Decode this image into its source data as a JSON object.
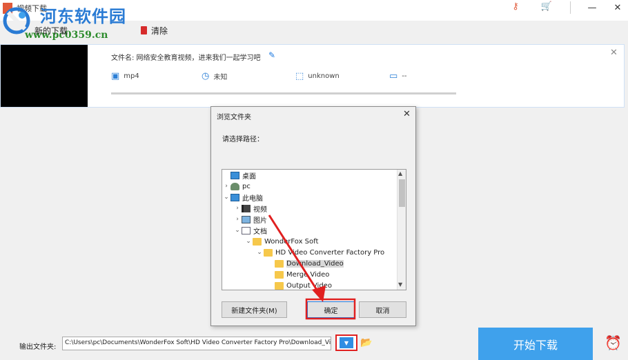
{
  "window": {
    "title": "视频下载"
  },
  "watermark": {
    "site_name": "河东软件园",
    "url": "www.pc0359.cn"
  },
  "toolbar": {
    "new_download": "新的下载",
    "clear": "清除"
  },
  "task": {
    "file_name_label": "文件名: 网络安全教育视频，进来我们一起学习吧",
    "format": "mp4",
    "duration": "未知",
    "resolution": "unknown",
    "size": "--",
    "progress": 0
  },
  "dialog": {
    "title": "浏览文件夹",
    "prompt": "请选择路径：",
    "tree": [
      {
        "label": "桌面",
        "icon": "desktop-icon",
        "arrow": ""
      },
      {
        "label": "pc",
        "icon": "user-icon",
        "arrow": "›"
      },
      {
        "label": "此电脑",
        "icon": "computer-icon",
        "arrow": "⌄"
      },
      {
        "label": "视频",
        "icon": "video-folder-icon",
        "arrow": "›"
      },
      {
        "label": "图片",
        "icon": "picture-folder-icon",
        "arrow": "›"
      },
      {
        "label": "文档",
        "icon": "document-folder-icon",
        "arrow": "⌄"
      },
      {
        "label": "WonderFox Soft",
        "icon": "folder-icon",
        "arrow": "⌄"
      },
      {
        "label": "HD Video Converter Factory Pro",
        "icon": "folder-icon",
        "arrow": "⌄"
      },
      {
        "label": "Download_Video",
        "icon": "folder-icon",
        "arrow": "",
        "selected": true
      },
      {
        "label": "Merge Video",
        "icon": "folder-icon",
        "arrow": ""
      },
      {
        "label": "Output Video",
        "icon": "folder-icon",
        "arrow": ""
      }
    ],
    "new_folder_button": "新建文件夹(M)",
    "ok_button": "确定",
    "cancel_button": "取消"
  },
  "output": {
    "label": "输出文件夹:",
    "path": "C:\\Users\\pc\\Documents\\WonderFox Soft\\HD Video Converter Factory Pro\\Download_Video\\"
  },
  "actions": {
    "start_download": "开始下载"
  },
  "colors": {
    "accent": "#3fa1ec",
    "annotation": "#e02020",
    "watermark_title": "#2a7bd4",
    "watermark_url": "#2d8c2d"
  }
}
